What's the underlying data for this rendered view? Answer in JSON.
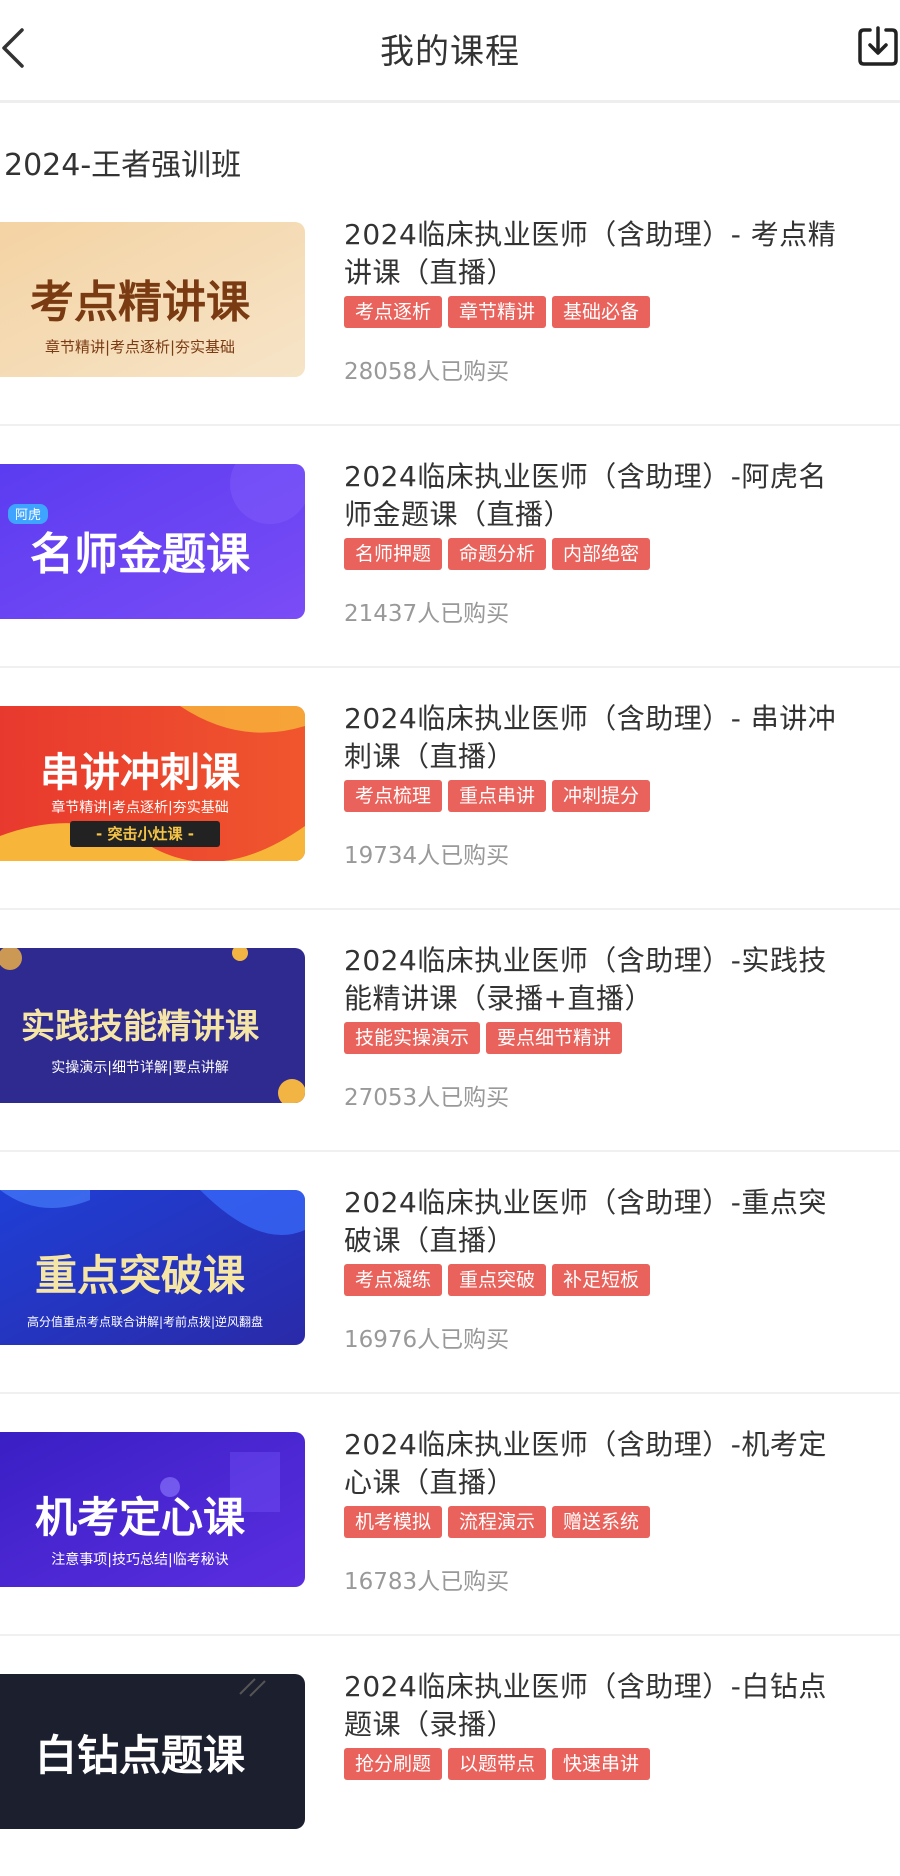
{
  "header": {
    "title": "我的课程",
    "back_icon": "chevron-left-icon",
    "download_icon": "download-icon"
  },
  "section": {
    "title": "2024-王者强训班"
  },
  "colors": {
    "tag_bg": "#e9625b",
    "tag_text": "#ffffff",
    "buyers_text": "#999999",
    "title_text": "#333333"
  },
  "courses": [
    {
      "title_line1": "2024临床执业医师（含助理）- 考点精",
      "title_line2": "讲课（直播）",
      "tags": [
        "考点逐析",
        "章节精讲",
        "基础必备"
      ],
      "buyers": "28058人已购买",
      "thumb": {
        "main": "考点精讲课",
        "sub": "章节精讲|考点逐析|夯实基础"
      }
    },
    {
      "title_line1": "2024临床执业医师（含助理）-阿虎名",
      "title_line2": "师金题课（直播）",
      "tags": [
        "名师押题",
        "命题分析",
        "内部绝密"
      ],
      "buyers": "21437人已购买",
      "thumb": {
        "main": "名师金题课",
        "badge": "阿虎"
      }
    },
    {
      "title_line1": "2024临床执业医师（含助理）- 串讲冲",
      "title_line2": "刺课（直播）",
      "tags": [
        "考点梳理",
        "重点串讲",
        "冲刺提分"
      ],
      "buyers": "19734人已购买",
      "thumb": {
        "main": "串讲冲刺课",
        "sub": "章节精讲|考点逐析|夯实基础",
        "ribbon": "- 突击小灶课 -"
      }
    },
    {
      "title_line1": "2024临床执业医师（含助理）-实践技",
      "title_line2": "能精讲课（录播+直播）",
      "tags": [
        "技能实操演示",
        "要点细节精讲"
      ],
      "buyers": "27053人已购买",
      "thumb": {
        "main": "实践技能精讲课",
        "sub": "实操演示|细节详解|要点讲解"
      }
    },
    {
      "title_line1": "2024临床执业医师（含助理）-重点突",
      "title_line2": "破课（直播）",
      "tags": [
        "考点凝练",
        "重点突破",
        "补足短板"
      ],
      "buyers": "16976人已购买",
      "thumb": {
        "main": "重点突破课",
        "sub": "高分值重点考点联合讲解|考前点拨|逆风翻盘"
      }
    },
    {
      "title_line1": "2024临床执业医师（含助理）-机考定",
      "title_line2": "心课（直播）",
      "tags": [
        "机考模拟",
        "流程演示",
        "赠送系统"
      ],
      "buyers": "16783人已购买",
      "thumb": {
        "main": "机考定心课",
        "sub": "注意事项|技巧总结|临考秘诀"
      }
    },
    {
      "title_line1": "2024临床执业医师（含助理）-白钻点",
      "title_line2": "题课（录播）",
      "tags": [
        "抢分刷题",
        "以题带点",
        "快速串讲"
      ],
      "buyers": "",
      "thumb": {
        "main": "白钻点题课"
      }
    }
  ]
}
